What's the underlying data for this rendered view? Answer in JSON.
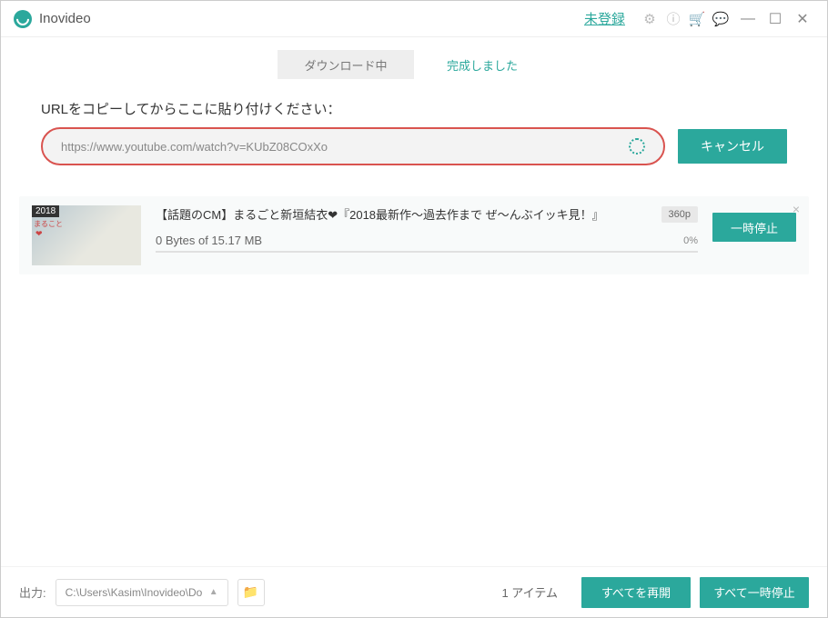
{
  "titlebar": {
    "app_name": "Inovideo",
    "login_link": "未登録"
  },
  "tabs": {
    "downloading": "ダウンロード中",
    "completed": "完成しました"
  },
  "url_section": {
    "label": "URLをコピーしてからここに貼り付けください：",
    "value": "https://www.youtube.com/watch?v=KUbZ08COxXo",
    "cancel": "キャンセル"
  },
  "item": {
    "thumb_year": "2018",
    "thumb_sub": "まること",
    "title": "【話題のCM】まるごと新垣結衣❤『2018最新作～過去作まで ぜ～んぶイッキ見！』",
    "quality": "360p",
    "progress_text": "0 Bytes of 15.17 MB",
    "percent": "0%",
    "pause": "一時停止"
  },
  "footer": {
    "out_label": "出力:",
    "out_path": "C:\\Users\\Kasim\\Inovideo\\Do",
    "item_count": "1 アイテム",
    "resume_all": "すべてを再開",
    "pause_all": "すべて一時停止"
  }
}
